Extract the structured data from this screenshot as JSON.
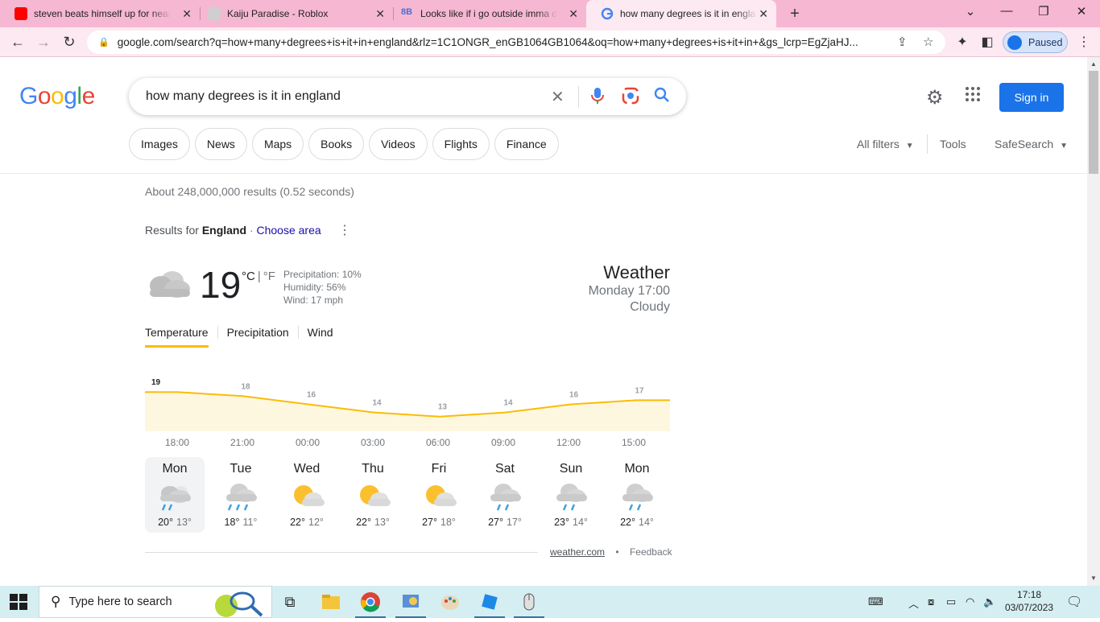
{
  "browser": {
    "tabs": [
      {
        "title": "steven beats himself up for nearl",
        "icon": "youtube-icon"
      },
      {
        "title": "Kaiju Paradise - Roblox",
        "icon": "roblox-icon"
      },
      {
        "title": "Looks like if i go outside imma di",
        "icon": "8b-icon"
      },
      {
        "title": "how many degrees is it in englan",
        "icon": "google-icon"
      }
    ],
    "url": "google.com/search?q=how+many+degrees+is+it+in+england&rlz=1C1ONGR_enGB1064GB1064&oq=how+many+degrees+is+it+in+&gs_lcrp=EgZjaHJ...",
    "profile_label": "Paused"
  },
  "search": {
    "logo": "Google",
    "query": "how many degrees is it in england",
    "sign_in": "Sign in",
    "chips": [
      "Images",
      "News",
      "Maps",
      "Books",
      "Videos",
      "Flights",
      "Finance"
    ],
    "all_filters": "All filters",
    "tools": "Tools",
    "safesearch": "SafeSearch",
    "stats": "About 248,000,000 results (0.52 seconds)",
    "results_for_prefix": "Results for",
    "results_for_place": "England",
    "choose_area": "Choose area"
  },
  "weather": {
    "temp": "19",
    "unit_c": "°C",
    "unit_sep": "|",
    "unit_f": "°F",
    "precipitation": "Precipitation: 10%",
    "humidity": "Humidity: 56%",
    "wind": "Wind: 17 mph",
    "title": "Weather",
    "time": "Monday 17:00",
    "condition": "Cloudy",
    "tabs": [
      "Temperature",
      "Precipitation",
      "Wind"
    ],
    "hours": [
      "18:00",
      "21:00",
      "00:00",
      "03:00",
      "06:00",
      "09:00",
      "12:00",
      "15:00"
    ],
    "days": [
      {
        "name": "Mon",
        "high": "20°",
        "low": "13°",
        "icon": "rain-sun-icon"
      },
      {
        "name": "Tue",
        "high": "18°",
        "low": "11°",
        "icon": "rain-icon"
      },
      {
        "name": "Wed",
        "high": "22°",
        "low": "12°",
        "icon": "partly-sunny-icon"
      },
      {
        "name": "Thu",
        "high": "22°",
        "low": "13°",
        "icon": "partly-sunny-icon"
      },
      {
        "name": "Fri",
        "high": "27°",
        "low": "18°",
        "icon": "partly-sunny-icon"
      },
      {
        "name": "Sat",
        "high": "27°",
        "low": "17°",
        "icon": "rain-icon"
      },
      {
        "name": "Sun",
        "high": "23°",
        "low": "14°",
        "icon": "rain-icon"
      },
      {
        "name": "Mon",
        "high": "22°",
        "low": "14°",
        "icon": "rain-icon"
      }
    ],
    "source": "weather.com",
    "bullet": "•",
    "feedback": "Feedback"
  },
  "chart_data": {
    "type": "area",
    "x": [
      "18:00",
      "21:00",
      "00:00",
      "03:00",
      "06:00",
      "09:00",
      "12:00",
      "15:00"
    ],
    "values": [
      19,
      18,
      16,
      14,
      13,
      14,
      16,
      17
    ],
    "title": "",
    "xlabel": "",
    "ylabel": "",
    "colors": {
      "line": "#fbbc04",
      "fill": "#fef7e0"
    }
  },
  "taskbar": {
    "search_placeholder": "Type here to search",
    "time": "17:18",
    "date": "03/07/2023"
  },
  "colors": {
    "accent": "#1a73e8",
    "tabbar": "#f6b7d2",
    "taskbar": "#d5eef2"
  }
}
